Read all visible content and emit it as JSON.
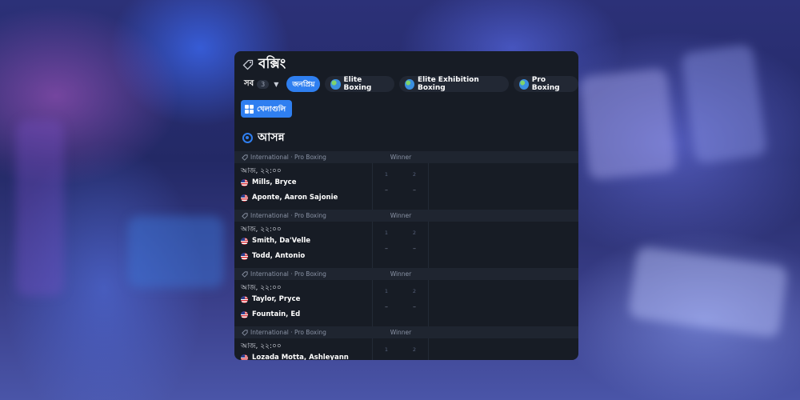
{
  "header": {
    "title": "বক্সিং",
    "icon": "tag-icon"
  },
  "filters": {
    "all_label": "সব",
    "all_count": "3",
    "chips": [
      {
        "label": "জনপ্রিয়",
        "active": true
      },
      {
        "label": "Elite Boxing",
        "icon": "globe-icon"
      },
      {
        "label": "Elite Exhibition Boxing",
        "icon": "globe-icon"
      },
      {
        "label": "Pro Boxing",
        "icon": "globe-icon"
      }
    ]
  },
  "games_button": {
    "label": "খেলাগুলি",
    "icon": "grid-icon"
  },
  "section": {
    "title": "আসন্ন",
    "icon": "clock-icon"
  },
  "events": [
    {
      "league": "International · Pro Boxing",
      "market": "Winner",
      "time": "আজ, ২২:০০",
      "home": "Mills, Bryce",
      "away": "Aponte, Aaron Sajonie",
      "col1": "1",
      "col2": "2",
      "odd1": "–",
      "odd2": "–"
    },
    {
      "league": "International · Pro Boxing",
      "market": "Winner",
      "time": "আজ, ২২:০০",
      "home": "Smith, Da'Velle",
      "away": "Todd, Antonio",
      "col1": "1",
      "col2": "2",
      "odd1": "–",
      "odd2": "–"
    },
    {
      "league": "International · Pro Boxing",
      "market": "Winner",
      "time": "আজ, ২২:০০",
      "home": "Taylor, Pryce",
      "away": "Fountain, Ed",
      "col1": "1",
      "col2": "2",
      "odd1": "–",
      "odd2": "–"
    },
    {
      "league": "International · Pro Boxing",
      "market": "Winner",
      "time": "আজ, ২২:০০",
      "home": "Lozada Motta, Ashleyann",
      "away": "",
      "col1": "1",
      "col2": "2",
      "odd1": "",
      "odd2": ""
    }
  ],
  "colors": {
    "accent": "#2f7ff0",
    "panel": "#171c25",
    "row_header": "#1f2530"
  }
}
